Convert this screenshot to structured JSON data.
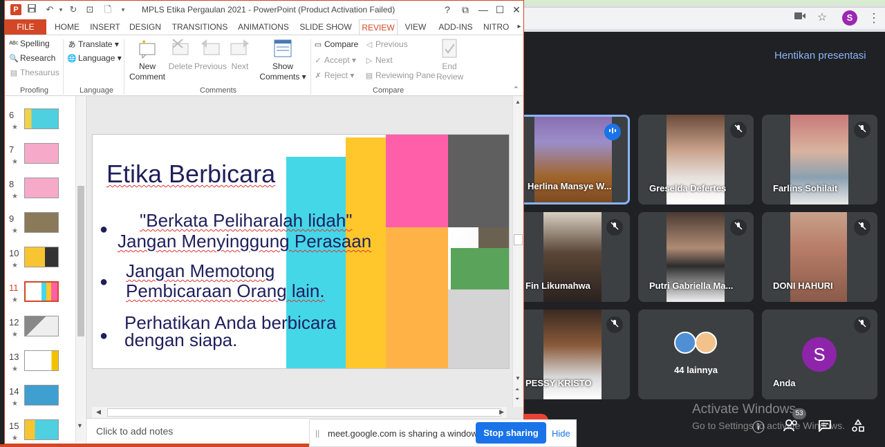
{
  "powerpoint": {
    "window_title": "MPLS Etika Pergaulan 2021 - PowerPoint (Product Activation Failed)",
    "logo_letter": "P",
    "window_controls": [
      "?",
      "⧉",
      "—",
      "☐",
      "✕"
    ],
    "tabs": [
      "FILE",
      "HOME",
      "INSERT",
      "DESIGN",
      "TRANSITIONS",
      "ANIMATIONS",
      "SLIDE SHOW",
      "REVIEW",
      "VIEW",
      "ADD-INS",
      "NITRO P"
    ],
    "active_tab": "REVIEW",
    "ribbon": {
      "proofing": {
        "spelling": "Spelling",
        "research": "Research",
        "thesaurus": "Thesaurus",
        "label": "Proofing"
      },
      "language": {
        "translate": "Translate",
        "language": "Language",
        "label": "Language"
      },
      "comments": {
        "new_comment": "New Comment",
        "delete": "Delete",
        "previous": "Previous",
        "next": "Next",
        "show_comments": "Show Comments",
        "label": "Comments"
      },
      "compare": {
        "compare": "Compare",
        "accept": "Accept",
        "reject": "Reject",
        "previous": "Previous",
        "next": "Next",
        "reviewing_pane": "Reviewing Pane",
        "end_review": "End Review",
        "label": "Compare"
      }
    },
    "thumbnails": [
      {
        "num": "6",
        "star": "★"
      },
      {
        "num": "7",
        "star": "★"
      },
      {
        "num": "8",
        "star": "★"
      },
      {
        "num": "9",
        "star": "★"
      },
      {
        "num": "10",
        "star": "★"
      },
      {
        "num": "11",
        "star": "★"
      },
      {
        "num": "12",
        "star": "★"
      },
      {
        "num": "13",
        "star": "★"
      },
      {
        "num": "14",
        "star": "★"
      },
      {
        "num": "15",
        "star": "★"
      }
    ],
    "slide": {
      "title": "Etika Berbicara",
      "bullets": [
        {
          "line1": "\"Berkata Peliharalah lidah\"",
          "line2": "Jangan Menyinggung Perasaan"
        },
        {
          "line1": "Jangan Memotong",
          "line2": "Pembicaraan Orang lain."
        },
        {
          "line1": "Perhatikan Anda berbicara",
          "line2": "dengan siapa."
        }
      ],
      "colors": {
        "cyan": "#44d7e8",
        "yellow": "#ffc72c",
        "pink": "#ff5fa8",
        "gray": "#5f5f5f",
        "orange": "#ffb347",
        "green": "#5aa35a",
        "light_gray": "#d4d4d4",
        "olive": "#6b6150"
      }
    },
    "notes_placeholder": "Click to add notes"
  },
  "meet": {
    "stop_presenting": "Hentikan presentasi",
    "participants": [
      {
        "name": "Herlina Mansye W...",
        "mic": "speaking"
      },
      {
        "name": "Greselda Defertes",
        "mic": "muted"
      },
      {
        "name": "Farlins Sohilait",
        "mic": "muted"
      },
      {
        "name": "Fin Likumahwa",
        "mic": "muted"
      },
      {
        "name": "Putri Gabriella Ma...",
        "mic": "muted"
      },
      {
        "name": "DONI HAHURI",
        "mic": "muted"
      },
      {
        "name": "PESSY KRISTO",
        "mic": "muted"
      },
      {
        "name": "44 lainnya",
        "mic": ""
      },
      {
        "name": "Anda",
        "mic": "muted"
      }
    ],
    "self_avatar_letter": "S",
    "profile_letter": "S",
    "participant_count": "53",
    "activate_title": "Activate Windows",
    "activate_sub": "Go to Settings to activate Windows."
  },
  "share_bar": {
    "grip": "||",
    "message": "meet.google.com is sharing a window.",
    "stop": "Stop sharing",
    "hide": "Hide"
  }
}
